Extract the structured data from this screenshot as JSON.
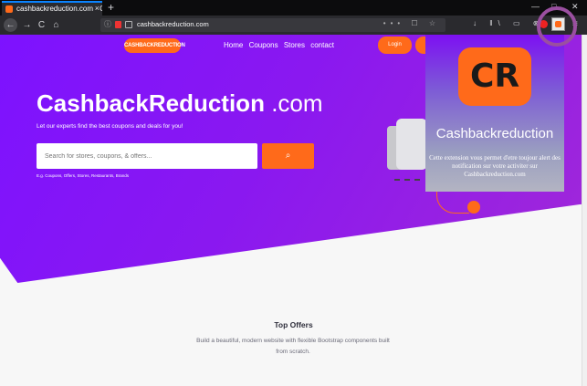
{
  "browser": {
    "tab": {
      "title": "cashbackreduction.com · Cashb"
    },
    "new_tab": "+",
    "window_controls": {
      "minimize": "—",
      "maximize": "□",
      "close": "✕"
    },
    "nav": {
      "back": "←",
      "forward": "→",
      "reload": "C",
      "home": "⌂"
    },
    "url": "cashbackreduction.com",
    "url_icons": "••• ☐ ☆",
    "toolbar_icons": "↓ ‖\\ ▭ ⊗",
    "menu": "≡"
  },
  "site": {
    "logo_text": "CASHBACKREDUCTION",
    "nav_links": [
      "Home",
      "Coupons",
      "Stores",
      "contact"
    ],
    "login_label": "Login",
    "hero_title_main": "CashbackReduction",
    "hero_title_domain": ".com",
    "hero_subtitle": "Let our experts find the best coupons and deals for you!",
    "search_placeholder": "Search for stores, coupons, & offers...",
    "search_button_icon": "⌕",
    "search_hint": "E.g. Coupons, Offers, Stores, Restaurants, Brands",
    "top_offers_title": "Top Offers",
    "top_offers_desc": "Build a beautiful, modern website with flexible Bootstrap components built from scratch."
  },
  "popup": {
    "logo_letters": "CR",
    "title": "Cashbackreduction",
    "description": "Cette extension vous permet d'etre toujour alert des notification sur votre activiter sur Cashbackreduction.com"
  },
  "colors": {
    "accent": "#ff6a1a",
    "hero_purple": "#7d12ff",
    "highlight_ring": "#9a4fa0"
  }
}
